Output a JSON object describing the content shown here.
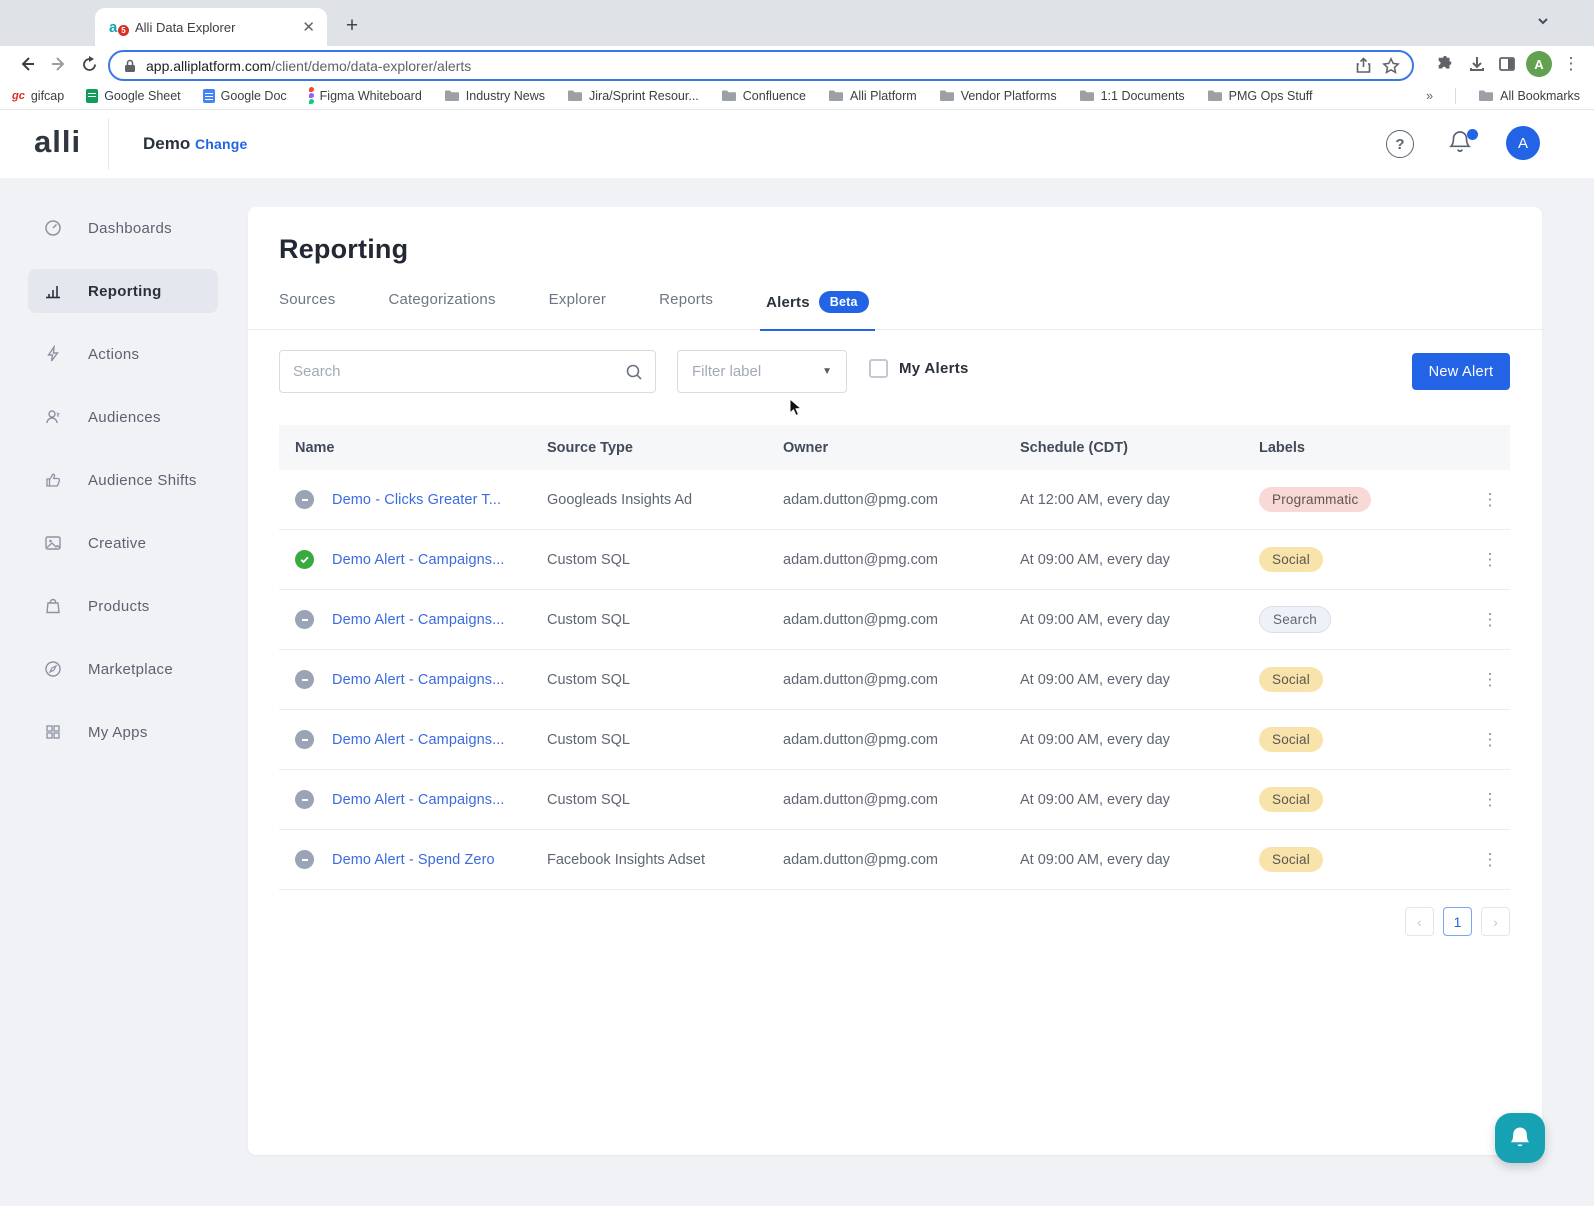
{
  "browser": {
    "tab_title": "Alli Data Explorer",
    "favicon_letter": "a",
    "favicon_badge": "5",
    "url_domain": "app.alliplatform.com",
    "url_path": "/client/demo/data-explorer/alerts",
    "bookmarks": [
      {
        "label": "gifcap"
      },
      {
        "label": "Google Sheet"
      },
      {
        "label": "Google Doc"
      },
      {
        "label": "Figma Whiteboard"
      },
      {
        "label": "Industry News"
      },
      {
        "label": "Jira/Sprint Resour..."
      },
      {
        "label": "Confluence"
      },
      {
        "label": "Alli Platform"
      },
      {
        "label": "Vendor Platforms"
      },
      {
        "label": "1:1 Documents"
      },
      {
        "label": "PMG Ops Stuff"
      }
    ],
    "bookmarks_overflow": "»",
    "all_bookmarks": "All Bookmarks",
    "profile_initial": "A"
  },
  "header": {
    "logo": "alli",
    "client_name": "Demo",
    "change_link": "Change",
    "avatar_initial": "A"
  },
  "sidebar": {
    "items": [
      {
        "label": "Dashboards"
      },
      {
        "label": "Reporting",
        "active": true
      },
      {
        "label": "Actions"
      },
      {
        "label": "Audiences"
      },
      {
        "label": "Audience Shifts"
      },
      {
        "label": "Creative"
      },
      {
        "label": "Products"
      },
      {
        "label": "Marketplace"
      },
      {
        "label": "My Apps"
      }
    ]
  },
  "main": {
    "title": "Reporting",
    "tabs": [
      {
        "label": "Sources"
      },
      {
        "label": "Categorizations"
      },
      {
        "label": "Explorer"
      },
      {
        "label": "Reports"
      },
      {
        "label": "Alerts",
        "badge": "Beta",
        "active": true
      }
    ],
    "controls": {
      "search_placeholder": "Search",
      "filter_placeholder": "Filter label",
      "my_alerts": "My Alerts",
      "new_alert": "New Alert"
    },
    "table": {
      "headers": {
        "name": "Name",
        "source": "Source Type",
        "owner": "Owner",
        "schedule": "Schedule (CDT)",
        "labels": "Labels"
      },
      "rows": [
        {
          "status": "paused",
          "name": "Demo - Clicks Greater T...",
          "source": "Googleads Insights Ad",
          "owner": "adam.dutton@pmg.com",
          "schedule": "At 12:00 AM, every day",
          "label": "Programmatic"
        },
        {
          "status": "active",
          "name": "Demo Alert - Campaigns...",
          "source": "Custom SQL",
          "owner": "adam.dutton@pmg.com",
          "schedule": "At 09:00 AM, every day",
          "label": "Social"
        },
        {
          "status": "paused",
          "name": "Demo Alert - Campaigns...",
          "source": "Custom SQL",
          "owner": "adam.dutton@pmg.com",
          "schedule": "At 09:00 AM, every day",
          "label": "Search"
        },
        {
          "status": "paused",
          "name": "Demo Alert - Campaigns...",
          "source": "Custom SQL",
          "owner": "adam.dutton@pmg.com",
          "schedule": "At 09:00 AM, every day",
          "label": "Social"
        },
        {
          "status": "paused",
          "name": "Demo Alert - Campaigns...",
          "source": "Custom SQL",
          "owner": "adam.dutton@pmg.com",
          "schedule": "At 09:00 AM, every day",
          "label": "Social"
        },
        {
          "status": "paused",
          "name": "Demo Alert - Campaigns...",
          "source": "Custom SQL",
          "owner": "adam.dutton@pmg.com",
          "schedule": "At 09:00 AM, every day",
          "label": "Social"
        },
        {
          "status": "paused",
          "name": "Demo Alert - Spend Zero",
          "source": "Facebook Insights Adset",
          "owner": "adam.dutton@pmg.com",
          "schedule": "At 09:00 AM, every day",
          "label": "Social"
        }
      ]
    },
    "pagination": {
      "prev": "‹",
      "page": "1",
      "next": "›"
    }
  },
  "colors": {
    "accent_blue": "#2264e5",
    "link_blue": "#3b6be0",
    "fab_teal": "#16a2b3",
    "status_active_green": "#3aa93f",
    "status_paused_gray": "#9aa4b6",
    "label_programmatic_bg": "#f9d9d5",
    "label_social_bg": "#f8e3ab",
    "label_search_bg": "#eef1f8"
  }
}
